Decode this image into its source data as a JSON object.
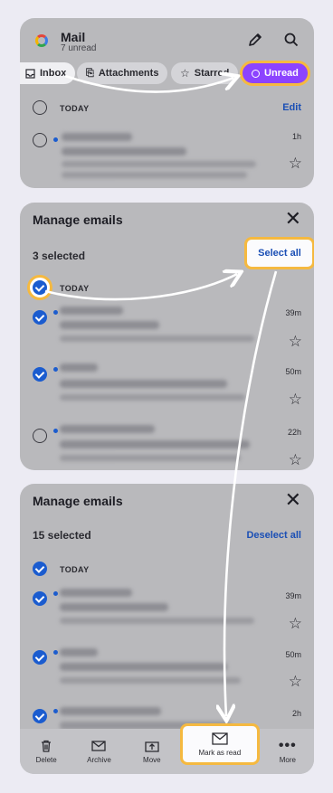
{
  "panel1": {
    "app_title": "Mail",
    "app_subtitle": "7 unread",
    "chips": [
      "Inbox",
      "Attachments",
      "Starred",
      "Unread"
    ],
    "section_label": "TODAY",
    "edit_label": "Edit",
    "row_time": "1h"
  },
  "panel2": {
    "title": "Manage emails",
    "selected_count": "3 selected",
    "select_all_label": "Select all",
    "section_label": "TODAY",
    "rows": [
      {
        "time": "39m"
      },
      {
        "time": "50m"
      },
      {
        "time": "22h"
      }
    ]
  },
  "panel3": {
    "title": "Manage emails",
    "selected_count": "15 selected",
    "deselect_all_label": "Deselect all",
    "section_label": "TODAY",
    "rows": [
      {
        "time": "39m"
      },
      {
        "time": "50m"
      },
      {
        "time": "2h"
      }
    ],
    "bottom_bar": [
      "Delete",
      "Archive",
      "Move",
      "Mark as read",
      "More"
    ]
  },
  "colors": {
    "accent_purple": "#8c43ff",
    "highlight_orange": "#f5b940",
    "link_blue": "#1b4fb5",
    "check_blue": "#1b5ccf"
  },
  "icons": [
    "google-logo-icon",
    "pencil-icon",
    "search-icon",
    "close-icon",
    "star-icon",
    "trash-icon",
    "archive-icon",
    "move-icon",
    "envelope-icon",
    "more-icon"
  ]
}
